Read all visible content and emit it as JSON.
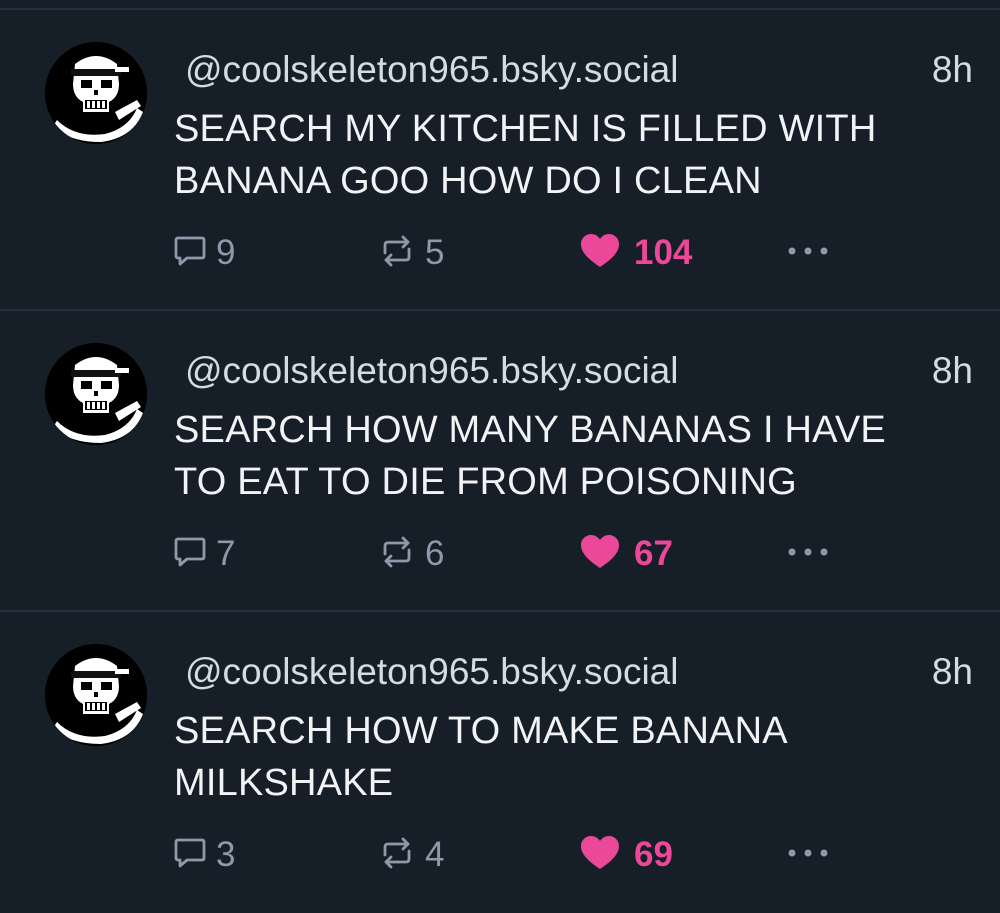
{
  "colors": {
    "background": "#161e27",
    "divider": "#262f3a",
    "text": "#f1f3f5",
    "muted": "#8c9aaa",
    "like": "#ec4899"
  },
  "icons": {
    "reply": "speech-bubble-icon",
    "repost": "repost-arrows-icon",
    "like": "heart-icon",
    "more": "ellipsis-icon"
  },
  "posts": [
    {
      "handle": "@coolskeleton965.bsky.social",
      "time": "8h",
      "text_line1": "SEARCH MY KITCHEN IS FILLED WITH",
      "text_line2": "BANANA GOO HOW DO I CLEAN",
      "replies": "9",
      "reposts": "5",
      "likes": "104",
      "liked": true
    },
    {
      "handle": "@coolskeleton965.bsky.social",
      "time": "8h",
      "text_line1": "SEARCH HOW MANY BANANAS I HAVE",
      "text_line2": "TO EAT TO DIE FROM POISONING",
      "replies": "7",
      "reposts": "6",
      "likes": "67",
      "liked": true
    },
    {
      "handle": "@coolskeleton965.bsky.social",
      "time": "8h",
      "text_line1": "SEARCH HOW TO MAKE BANANA",
      "text_line2": "MILKSHAKE",
      "replies": "3",
      "reposts": "4",
      "likes": "69",
      "liked": true
    }
  ]
}
